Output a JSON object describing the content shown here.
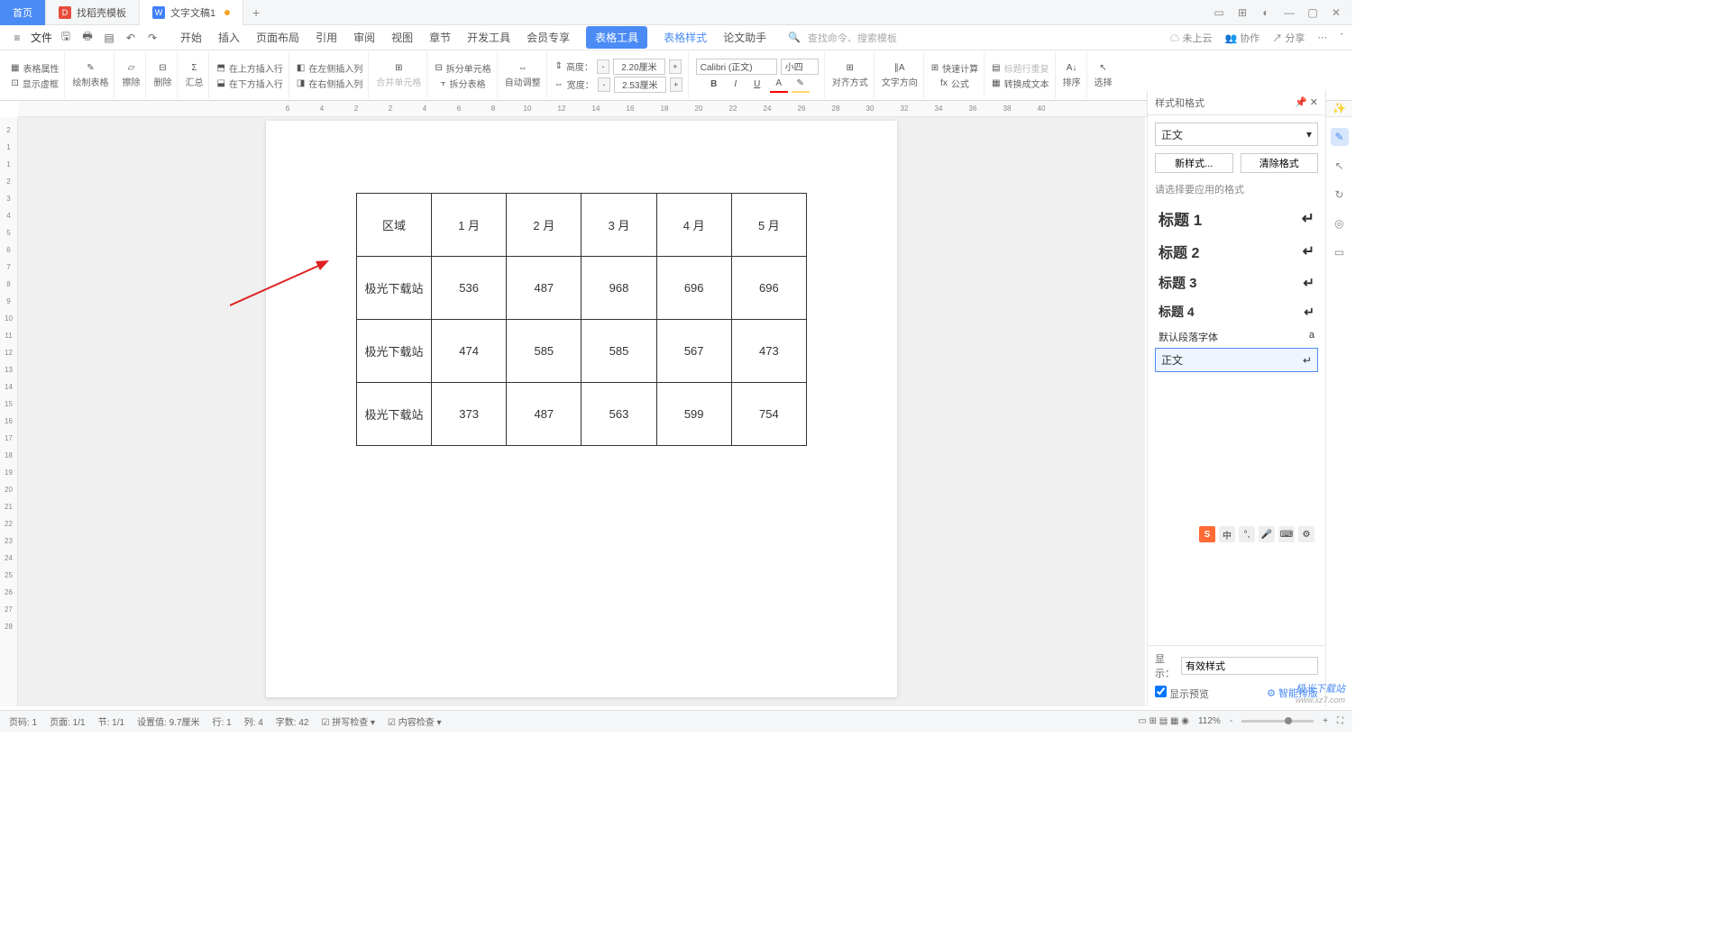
{
  "tabs": {
    "home": "首页",
    "template": "找稻壳模板",
    "doc": "文字文稿1"
  },
  "menubar": {
    "file": "文件",
    "items": [
      "开始",
      "插入",
      "页面布局",
      "引用",
      "审阅",
      "视图",
      "章节",
      "开发工具",
      "会员专享",
      "表格工具",
      "表格样式",
      "论文助手"
    ],
    "search_cmd": "查找命令、搜索模板",
    "search_prefix": "Q",
    "right": {
      "cloud": "未上云",
      "coop": "协作",
      "share": "分享"
    }
  },
  "ribbon": {
    "tbl_props": "表格属性",
    "show_dashed": "显示虚框",
    "draw_tbl": "绘制表格",
    "erase": "擦除",
    "del": "删除",
    "sum": "汇总",
    "ins_above": "在上方插入行",
    "ins_below": "在下方插入行",
    "ins_left": "在左侧插入列",
    "ins_right": "在右侧插入列",
    "merge": "合并单元格",
    "split_cell": "拆分单元格",
    "split_tbl": "拆分表格",
    "auto_adj": "自动调整",
    "height_lbl": "高度：",
    "width_lbl": "宽度：",
    "height_val": "2.20厘米",
    "width_val": "2.53厘米",
    "font_name": "Calibri (正文)",
    "font_size": "小四",
    "align": "对齐方式",
    "text_dir": "文字方向",
    "fast_calc": "快速计算",
    "formula": "公式",
    "header_repeat": "标题行重复",
    "to_text": "转换成文本",
    "sort": "排序",
    "select": "选择"
  },
  "ruler_h": [
    "6",
    "4",
    "2",
    "2",
    "4",
    "6",
    "8",
    "10",
    "12",
    "14",
    "16",
    "18",
    "20",
    "22",
    "24",
    "26",
    "28",
    "30",
    "32",
    "34",
    "36",
    "38",
    "40"
  ],
  "ruler_v": [
    "2",
    "1",
    "1",
    "2",
    "3",
    "4",
    "5",
    "6",
    "7",
    "8",
    "9",
    "10",
    "11",
    "12",
    "13",
    "14",
    "15",
    "16",
    "17",
    "18",
    "19",
    "20",
    "21",
    "22",
    "23",
    "24",
    "25",
    "26",
    "27",
    "28"
  ],
  "table": {
    "headers": [
      "区域",
      "1 月",
      "2 月",
      "3 月",
      "4 月",
      "5 月"
    ],
    "rows": [
      [
        "极光下载站",
        "536",
        "487",
        "968",
        "696",
        "696"
      ],
      [
        "极光下载站",
        "474",
        "585",
        "585",
        "567",
        "473"
      ],
      [
        "极光下载站",
        "373",
        "487",
        "563",
        "599",
        "754"
      ]
    ]
  },
  "rpanel": {
    "title": "样式和格式",
    "current": "正文",
    "new_style": "新样式...",
    "clear_fmt": "清除格式",
    "prompt": "请选择要应用的格式",
    "styles": [
      "标题 1",
      "标题 2",
      "标题 3",
      "标题 4"
    ],
    "default_font": "默认段落字体",
    "selected_style": "正文",
    "show_lbl": "显示：",
    "show_val": "有效样式",
    "preview_chk": "显示预览",
    "smart_layout": "智能排版"
  },
  "status": {
    "page_no": "页码: 1",
    "page": "页面: 1/1",
    "sec": "节: 1/1",
    "pos": "设置值: 9.7厘米",
    "line": "行: 1",
    "col": "列: 4",
    "chars": "字数: 42",
    "spell": "拼写检查",
    "content": "内容检查",
    "zoom": "112%"
  },
  "watermark": {
    "name": "极光下载站",
    "url": "www.xz7.com"
  }
}
